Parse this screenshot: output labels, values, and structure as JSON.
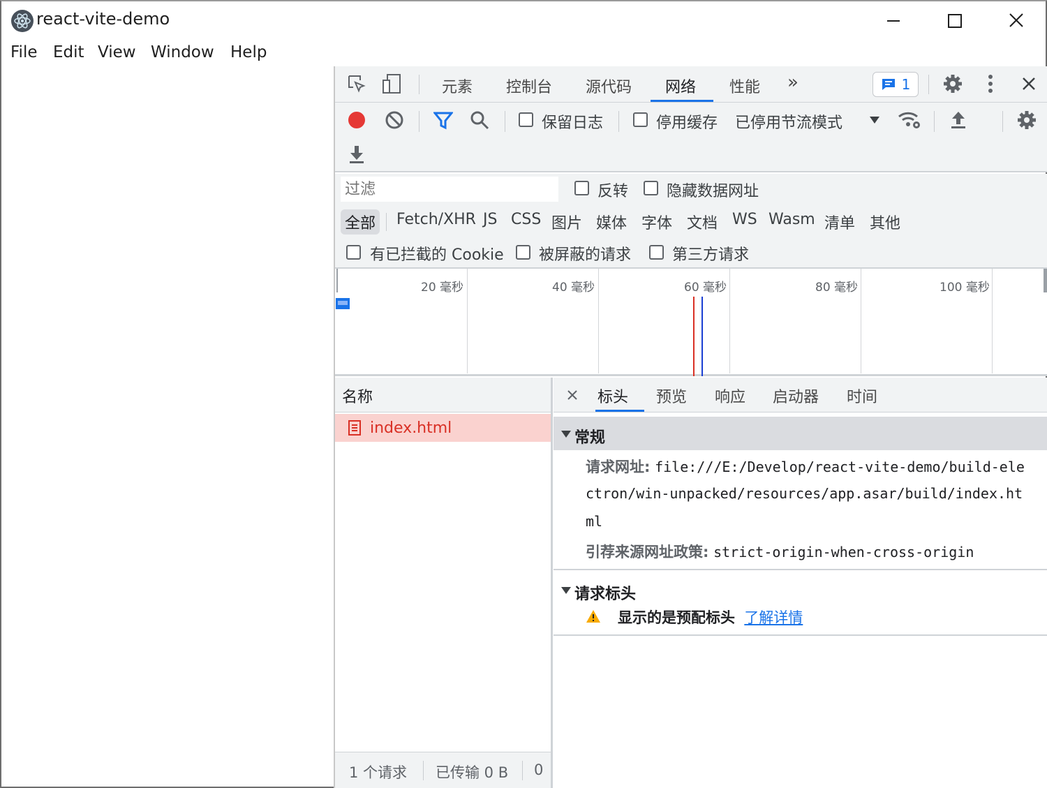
{
  "window": {
    "title": "react-vite-demo"
  },
  "menu": [
    "File",
    "Edit",
    "View",
    "Window",
    "Help"
  ],
  "devtools": {
    "tabs": [
      "元素",
      "控制台",
      "源代码",
      "网络",
      "性能"
    ],
    "active_tab": "网络",
    "more_tabs_label": "»",
    "issues_count": "1",
    "toolbar": {
      "preserve_log": "保留日志",
      "disable_cache": "停用缓存",
      "throttling": "已停用节流模式"
    },
    "filter": {
      "placeholder": "过滤",
      "invert": "反转",
      "hide_data_urls": "隐藏数据网址",
      "types": [
        "全部",
        "Fetch/XHR",
        "JS",
        "CSS",
        "图片",
        "媒体",
        "字体",
        "文档",
        "WS",
        "Wasm",
        "清单",
        "其他"
      ],
      "active_type": "全部",
      "blocked_cookies": "有已拦截的 Cookie",
      "blocked_requests": "被屏蔽的请求",
      "third_party": "第三方请求"
    },
    "timeline": {
      "ticks": [
        "20 毫秒",
        "40 毫秒",
        "60 毫秒",
        "80 毫秒",
        "100 毫秒"
      ]
    },
    "requests": {
      "column_name": "名称",
      "rows": [
        {
          "name": "index.html"
        }
      ]
    },
    "status": {
      "count": "1 个请求",
      "transferred": "已传输 0 B",
      "resources": "0"
    },
    "details": {
      "tabs": [
        "标头",
        "预览",
        "响应",
        "启动器",
        "时间"
      ],
      "active_tab": "标头",
      "general": {
        "title": "常规",
        "request_url_label": "请求网址:",
        "request_url_line1": "file:///E:/Develop/react-vite-demo/build-ele",
        "request_url_line2": "ctron/win-unpacked/resources/app.asar/build/index.ht",
        "request_url_line3": "ml",
        "referrer_policy_label": "引荐来源网址政策:",
        "referrer_policy_value": "strict-origin-when-cross-origin"
      },
      "request_headers": {
        "title": "请求标头",
        "warning": "显示的是预配标头",
        "learn_more": "了解详情"
      }
    },
    "colors": {
      "record": "#e53935",
      "accent": "#1a73e8",
      "selected_row": "#fad2cf",
      "selected_text": "#d93025"
    }
  }
}
